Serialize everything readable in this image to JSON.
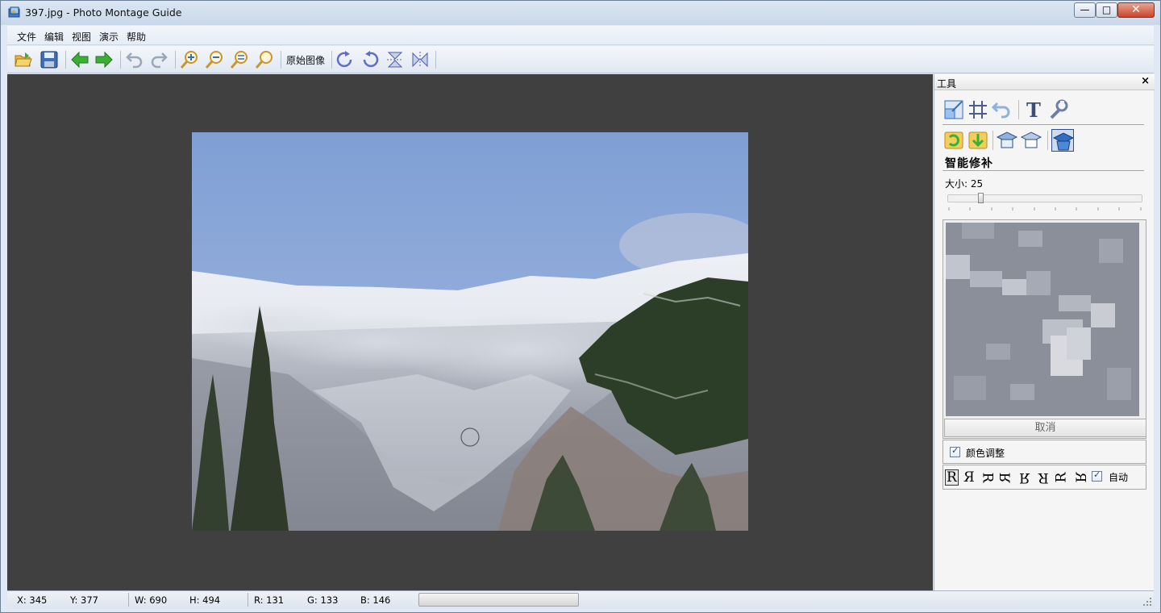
{
  "window": {
    "title": "397.jpg - Photo Montage Guide",
    "minimize_glyph": "—",
    "maximize_glyph": "□",
    "close_glyph": "✕"
  },
  "menu": [
    "文件",
    "编辑",
    "视图",
    "演示",
    "帮助"
  ],
  "toolbar": {
    "original_image_label": "原始图像",
    "icons": [
      "open-folder-icon",
      "save-icon",
      "back-arrow-icon",
      "forward-arrow-icon",
      "undo-icon",
      "redo-icon",
      "zoom-in-icon",
      "zoom-out-icon",
      "zoom-fit-icon",
      "zoom-actual-icon",
      "rotate-right-icon",
      "rotate-left-icon",
      "flip-vertical-icon",
      "flip-horizontal-icon"
    ]
  },
  "panel": {
    "title": "工具",
    "close_glyph": "×",
    "section_title": "智能修补",
    "size_label": "大小: 25",
    "size_value": 25,
    "cancel_label": "取消",
    "color_adjust_label": "颜色调整",
    "color_adjust_checked": true,
    "orientation_glyphs": [
      "R",
      "Я",
      "ꓤ",
      "ᴚ"
    ],
    "auto_label": "自动",
    "auto_checked": true
  },
  "status": {
    "x": "X: 345",
    "y": "Y: 377",
    "w": "W: 690",
    "h": "H: 494",
    "r": "R: 131",
    "g": "G: 133",
    "b": "B: 146"
  },
  "colors": {
    "canvas_bg": "#404040",
    "accent_blue": "#2f6ec4",
    "green_arrow": "#3cb034"
  }
}
